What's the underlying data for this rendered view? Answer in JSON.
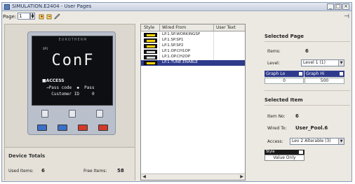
{
  "window": {
    "title": "SIMULATION.E2404 - User Pages",
    "buttons": [
      "_",
      "□",
      "×"
    ]
  },
  "toolbar": {
    "page_label": "Page:",
    "page_value": "1"
  },
  "device": {
    "brand": "EUROTHERM",
    "sp_label": "SP1",
    "display_text": "ConF",
    "access_label": "■ACCESS",
    "pass_code_line": "→Pass code  ◆  Pass",
    "customer_id_line": "  Customer ID     0"
  },
  "totals": {
    "title": "Device Totals",
    "used_label": "Used Items:",
    "used_value": "6",
    "free_label": "Free Items:",
    "free_value": "58"
  },
  "table": {
    "headers": [
      "Style",
      "Wired From",
      "User Text"
    ],
    "rows": [
      {
        "wired": "LP.1.SP.WORKINGSP",
        "style": "yellow",
        "selected": false
      },
      {
        "wired": "LP.1.SP.SP1",
        "style": "yellow",
        "selected": false
      },
      {
        "wired": "LP.1.SP.SP2",
        "style": "yellow",
        "selected": false
      },
      {
        "wired": "LP.1.OP.CH1OP",
        "style": "plain",
        "selected": false
      },
      {
        "wired": "LP.1.OP.CH2OP",
        "style": "plain",
        "selected": false
      },
      {
        "wired": "LP.1.TUNE.ENABLE",
        "style": "yellow",
        "selected": true
      }
    ]
  },
  "selected_page": {
    "title": "Selected Page",
    "items_label": "Items:",
    "items_value": "6",
    "level_label": "Level:",
    "level_value": "Level 1 (1)",
    "graph_lo_label": "Graph Lo",
    "graph_hi_label": "Graph Hi",
    "graph_lo_value": "0",
    "graph_hi_value": "500"
  },
  "selected_item": {
    "title": "Selected Item",
    "item_no_label": "Item No:",
    "item_no_value": "6",
    "wired_to_label": "Wired To:",
    "wired_to_value": "User_Pool.6",
    "access_label": "Access:",
    "access_value": "Lev 2 Alterable (3)",
    "style_label": "Style",
    "style_value": "Value Only"
  },
  "colors": {
    "selection": "#2e3a8c",
    "chip_yellow": "#ffd400",
    "button_blue": "#3b6fc8",
    "button_red": "#d23b2b"
  }
}
